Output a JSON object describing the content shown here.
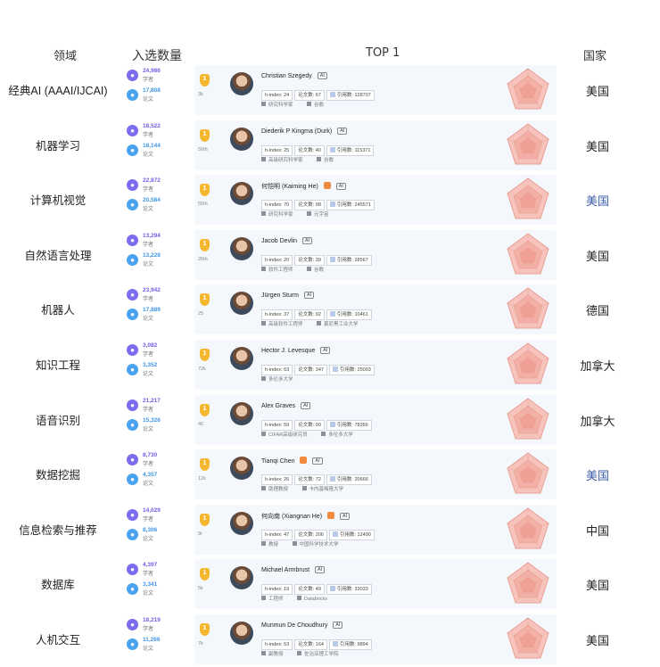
{
  "headers": {
    "field": "领域",
    "count": "入选数量",
    "top": "TOP 1",
    "country": "国家"
  },
  "count_labels": {
    "scholar": "学者",
    "paper": "论文"
  },
  "stat_labels": {
    "h": "h-index:",
    "papers": "论文数:",
    "cites": "引用数:"
  },
  "ai_tag": "AI",
  "rows": [
    {
      "field": "经典AI (AAAI/IJCAI)",
      "scholars": "24,986",
      "papers": "17,808",
      "rank_note": "3k",
      "name": "Christian Szegedy",
      "h": "24",
      "p": "67",
      "c": "128707",
      "aff1": "研究科学家",
      "aff2": "谷歌",
      "country": "美国",
      "country_color": "#222222",
      "orange_tag": false
    },
    {
      "field": "机器学习",
      "scholars": "18,522",
      "papers": "18,144",
      "rank_note": "50th",
      "name": "Diederik P Kingma (Durk)",
      "h": "25",
      "p": "40",
      "c": "115371",
      "aff1": "高级研究科学家",
      "aff2": "谷歌",
      "country": "美国",
      "country_color": "#222222",
      "orange_tag": false
    },
    {
      "field": "计算机视觉",
      "scholars": "22,872",
      "papers": "20,584",
      "rank_note": "55th",
      "name": "何恺明 (Kaiming He)",
      "h": "70",
      "p": "98",
      "c": "245571",
      "aff1": "研究科学家",
      "aff2": "元宇宙",
      "country": "美国",
      "country_color": "#3a5ba8",
      "orange_tag": true
    },
    {
      "field": "自然语言处理",
      "scholars": "13,294",
      "papers": "13,228",
      "rank_note": "26th",
      "name": "Jacob Devlin",
      "h": "20",
      "p": "39",
      "c": "28567",
      "aff1": "软件工程师",
      "aff2": "谷歌",
      "country": "美国",
      "country_color": "#222222",
      "orange_tag": false
    },
    {
      "field": "机器人",
      "scholars": "23,942",
      "papers": "17,889",
      "rank_note": "25",
      "name": "Jürgen Sturm",
      "h": "37",
      "p": "92",
      "c": "10461",
      "aff1": "高级软件工程师",
      "aff2": "慕尼黑工业大学",
      "country": "德国",
      "country_color": "#222222",
      "orange_tag": false
    },
    {
      "field": "知识工程",
      "scholars": "3,082",
      "papers": "3,352",
      "rank_note": "72k",
      "name": "Hector J. Levesque",
      "h": "63",
      "p": "347",
      "c": "25003",
      "aff1": "多伦多大学",
      "aff2": "",
      "country": "加拿大",
      "country_color": "#222222",
      "orange_tag": false
    },
    {
      "field": "语音识别",
      "scholars": "21,217",
      "papers": "15,326",
      "rank_note": "46",
      "name": "Alex Graves",
      "h": "59",
      "p": "99",
      "c": "78356",
      "aff1": "CIFAR高级研究员",
      "aff2": "多伦多大学",
      "country": "加拿大",
      "country_color": "#222222",
      "orange_tag": false
    },
    {
      "field": "数据挖掘",
      "scholars": "8,730",
      "papers": "4,357",
      "rank_note": "12k",
      "name": "Tianqi Chen",
      "h": "26",
      "p": "72",
      "c": "20666",
      "aff1": "助理教授",
      "aff2": "卡内基梅隆大学",
      "country": "美国",
      "country_color": "#3a5ba8",
      "orange_tag": true
    },
    {
      "field": "信息检索与推荐",
      "scholars": "14,029",
      "papers": "8,306",
      "rank_note": "9r",
      "name": "何向南 (Xiangnan He)",
      "h": "47",
      "p": "206",
      "c": "12490",
      "aff1": "教授",
      "aff2": "中国科学技术大学",
      "country": "中国",
      "country_color": "#222222",
      "orange_tag": true
    },
    {
      "field": "数据库",
      "scholars": "4,397",
      "papers": "3,341",
      "rank_note": "5k",
      "name": "Michael Armbrust",
      "h": "19",
      "p": "49",
      "c": "33033",
      "aff1": "工程师",
      "aff2": "Databricks",
      "country": "美国",
      "country_color": "#222222",
      "orange_tag": false
    },
    {
      "field": "人机交互",
      "scholars": "18,219",
      "papers": "11,266",
      "rank_note": "7k",
      "name": "Munmun De Choudhury",
      "h": "53",
      "p": "164",
      "c": "9894",
      "aff1": "副教授",
      "aff2": "佐治亚理工学院",
      "country": "美国",
      "country_color": "#222222",
      "orange_tag": false
    }
  ]
}
